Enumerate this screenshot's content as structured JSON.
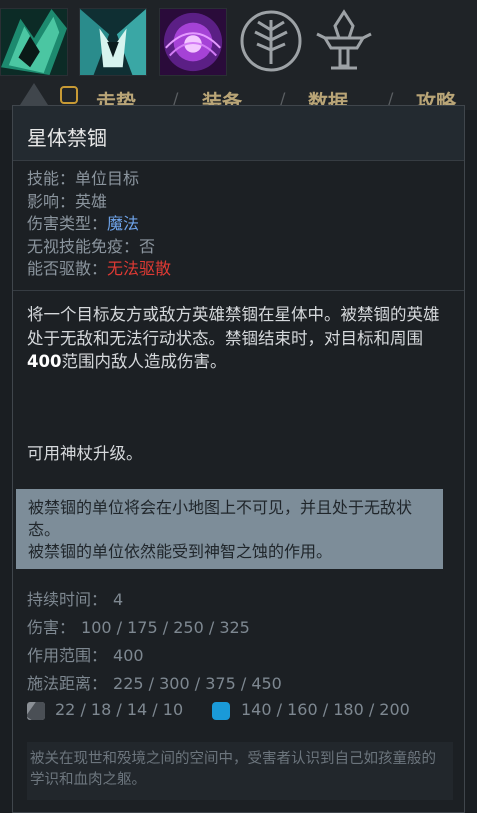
{
  "icon_strip": {
    "abilities": [
      {
        "icon": "ability-green-slash-icon"
      },
      {
        "icon": "ability-teal-horns-icon"
      },
      {
        "icon": "ability-purple-vortex-icon"
      }
    ],
    "talent_icon": "talent-tree-icon",
    "scepter_icon": "aghanim-scepter-icon"
  },
  "tab_bar": {
    "tabs": [
      "走势",
      "装备",
      "数据",
      "攻略"
    ]
  },
  "tooltip": {
    "title": "星体禁锢",
    "attributes": [
      {
        "key": "技能：",
        "value": "单位目标",
        "style": "normal"
      },
      {
        "key": "影响：",
        "value": "英雄",
        "style": "normal"
      },
      {
        "key": "伤害类型：",
        "value": "魔法",
        "style": "magic"
      },
      {
        "key": "无视技能免疫：",
        "value": "否",
        "style": "normal"
      },
      {
        "key": "能否驱散：",
        "value": "无法驱散",
        "style": "red"
      }
    ],
    "description_pre": "将一个目标友方或敌方英雄禁锢在星体中。被禁锢的英雄处于无敌和无法行动状态。禁锢结束时，对目标和周围",
    "description_bold": "400",
    "description_post": "范围内敌人造成伤害。",
    "upgrade_note": "可用神杖升级。",
    "notes": [
      "被禁锢的单位将会在小地图上不可见，并且处于无敌状态。",
      "被禁锢的单位依然能受到神智之蚀的作用。"
    ],
    "stats": [
      {
        "key": "持续时间：",
        "value": "4"
      },
      {
        "key": "伤害：",
        "value": "100 / 175 / 250 / 325"
      },
      {
        "key": "作用范围：",
        "value": "400"
      },
      {
        "key": "施法距离：",
        "value": "225 / 300 / 375 / 450"
      }
    ],
    "cooldown": "22 / 18 / 14 / 10",
    "mana_cost": "140 / 160 / 180 / 200",
    "lore": "被关在现世和殁境之间的空间中，受害者认识到自己如孩童般的学识和血肉之躯。"
  },
  "colors": {
    "magic": "#6fa4ea",
    "undispellable": "#e03a34",
    "note_bg": "#7d8d99",
    "mana": "#1a9ad8",
    "tab_gold": "#b9a577"
  }
}
